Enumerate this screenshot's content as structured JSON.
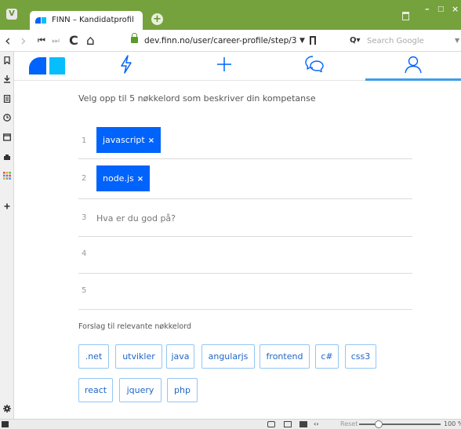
{
  "browser": {
    "tab_title": "FINN – Kandidatprofil",
    "new_tab": "+",
    "window_controls": {
      "minimize": "–",
      "maximize": "□",
      "close": "×"
    },
    "nav": {
      "back": "‹",
      "forward": "›",
      "first": "⏮",
      "rewind": "⏭",
      "reload": "C",
      "home": "⌂"
    },
    "url": "dev.finn.no/user/career-profile/step/3",
    "url_dropdown": "▼",
    "search_engine_glyph": "Q▾",
    "search_placeholder": "Search Google",
    "search_dropdown": "▼",
    "colors": {
      "titlebar": "#76a23d",
      "lock": "#5a9a2a"
    }
  },
  "sidepanel": {
    "icons": [
      "bookmark-icon",
      "download-icon",
      "notes-icon",
      "history-icon",
      "window-icon",
      "extensions-icon",
      "apps-icon",
      "add-panel-icon",
      "settings-icon"
    ]
  },
  "statusbar": {
    "reset_label": "Reset",
    "zoom": "100 %"
  },
  "app": {
    "brand_colors": {
      "primary": "#0063fb",
      "secondary": "#06befb",
      "accent": "#3c9fe8"
    },
    "nav_icons": [
      "lightning-icon",
      "plus-icon",
      "chat-icon",
      "user-icon"
    ],
    "instruction": "Velg opp til 5 nøkkelord som beskriver din kompetanse",
    "keywords": [
      {
        "num": "1",
        "label": "javascript",
        "remove": "×"
      },
      {
        "num": "2",
        "label": "node.js",
        "remove": "×"
      }
    ],
    "input_row_num": "3",
    "input_placeholder": "Hva er du god på?",
    "empty_row_nums": [
      "4",
      "5"
    ],
    "suggestions_label": "Forslag til relevante nøkkelord",
    "suggestions": [
      ".net",
      "utvikler",
      "java",
      "angularjs",
      "frontend",
      "c#",
      "css3",
      "react",
      "jquery",
      "php"
    ]
  }
}
